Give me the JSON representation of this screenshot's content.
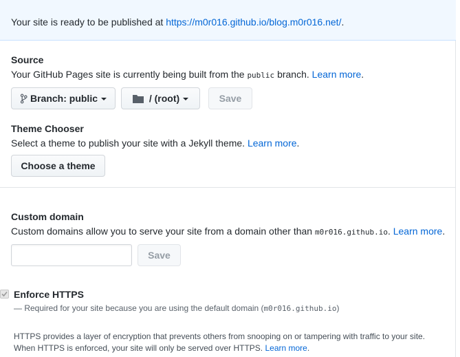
{
  "flash": {
    "prefix": "Your site is ready to be published at ",
    "url": "https://m0r016.github.io/blog.m0r016.net/",
    "suffix": "."
  },
  "source": {
    "heading": "Source",
    "desc_prefix": "Your GitHub Pages site is currently being built from the ",
    "branch_code": "public",
    "desc_suffix": " branch. ",
    "learn_more": "Learn more",
    "period": ".",
    "branch_button": "Branch: public",
    "folder_button": "/ (root)",
    "save_button": "Save"
  },
  "theme": {
    "heading": "Theme Chooser",
    "desc": "Select a theme to publish your site with a Jekyll theme. ",
    "learn_more": "Learn more",
    "period": ".",
    "choose_button": "Choose a theme"
  },
  "custom_domain": {
    "heading": "Custom domain",
    "desc_prefix": "Custom domains allow you to serve your site from a domain other than ",
    "domain_code": "m0r016.github.io",
    "desc_suffix": ". ",
    "learn_more": "Learn more",
    "period": ".",
    "input_value": "",
    "input_placeholder": "",
    "save_button": "Save"
  },
  "https": {
    "label": "Enforce HTTPS",
    "note_prefix": "— Required for your site because you are using the default domain (",
    "note_code": "m0r016.github.io",
    "note_suffix": ")",
    "info_line1": "HTTPS provides a layer of encryption that prevents others from snooping on or tampering with traffic to your site.",
    "info_line2_prefix": "When HTTPS is enforced, your site will only be served over HTTPS. ",
    "learn_more": "Learn more",
    "period": ".",
    "checked": true
  }
}
